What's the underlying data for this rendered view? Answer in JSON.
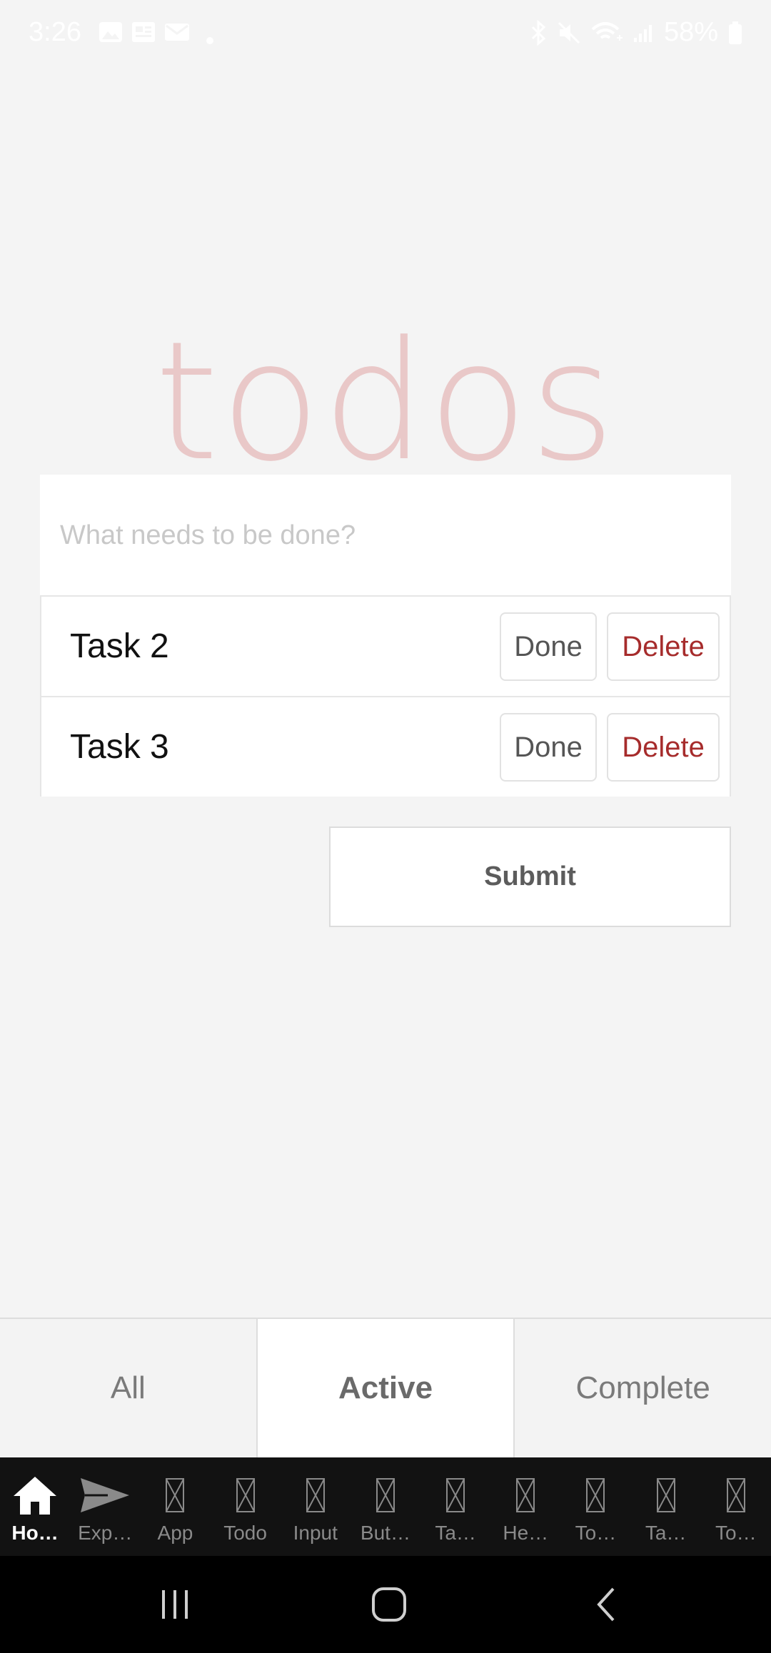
{
  "status_bar": {
    "time": "3:26",
    "battery": "58%",
    "icons": [
      "gallery-icon",
      "news-icon",
      "mail-icon",
      "dot-icon",
      "bluetooth-icon",
      "mute-icon",
      "wifi-icon",
      "signal-icon",
      "battery-icon"
    ]
  },
  "app": {
    "title": "todos",
    "new_todo_placeholder": "What needs to be done?",
    "todos": [
      {
        "label": "Task 2",
        "done_label": "Done",
        "delete_label": "Delete"
      },
      {
        "label": "Task 3",
        "done_label": "Done",
        "delete_label": "Delete"
      }
    ],
    "submit_label": "Submit",
    "filters": [
      {
        "label": "All",
        "active": false
      },
      {
        "label": "Active",
        "active": true
      },
      {
        "label": "Complete",
        "active": false
      }
    ]
  },
  "tabbar": {
    "items": [
      {
        "label": "Ho…",
        "icon": "home-icon",
        "active": true
      },
      {
        "label": "Exp…",
        "icon": "send-icon",
        "active": false
      },
      {
        "label": "App",
        "icon": "missing-glyph-icon",
        "active": false
      },
      {
        "label": "Todo",
        "icon": "missing-glyph-icon",
        "active": false
      },
      {
        "label": "Input",
        "icon": "missing-glyph-icon",
        "active": false
      },
      {
        "label": "But…",
        "icon": "missing-glyph-icon",
        "active": false
      },
      {
        "label": "Ta…",
        "icon": "missing-glyph-icon",
        "active": false
      },
      {
        "label": "He…",
        "icon": "missing-glyph-icon",
        "active": false
      },
      {
        "label": "To…",
        "icon": "missing-glyph-icon",
        "active": false
      },
      {
        "label": "Ta…",
        "icon": "missing-glyph-icon",
        "active": false
      },
      {
        "label": "To…",
        "icon": "missing-glyph-icon",
        "active": false
      }
    ]
  },
  "system_nav": {
    "icons": [
      "recents-icon",
      "home-nav-icon",
      "back-icon"
    ]
  },
  "colors": {
    "background": "#f4f4f4",
    "title": "#e8c4c4",
    "delete": "#a62c2c",
    "tabbar": "#121212"
  }
}
